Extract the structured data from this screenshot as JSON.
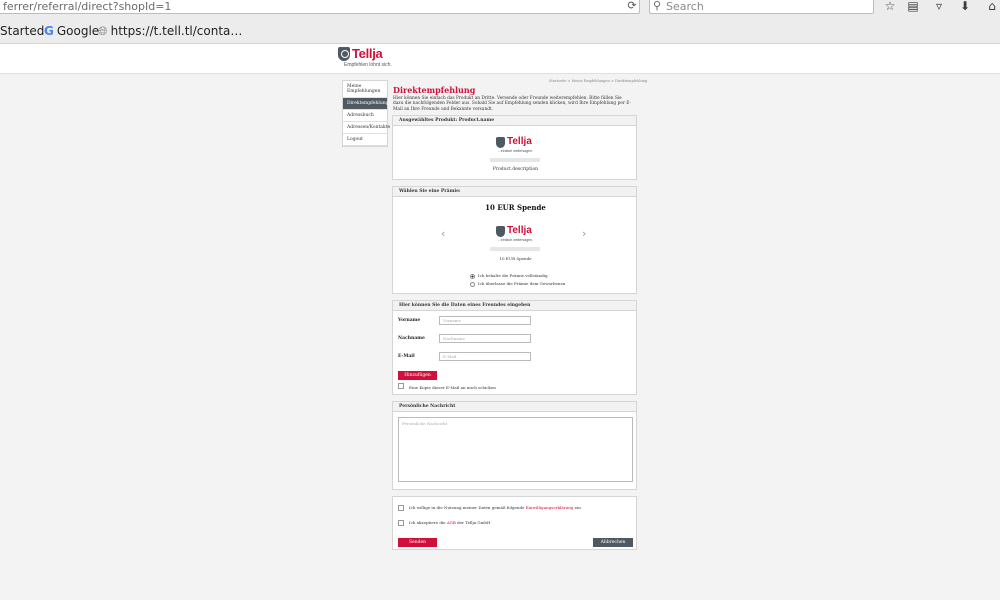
{
  "browser": {
    "url": "ferrer/referral/direct?shopId=1",
    "search_placeholder": "Search",
    "bookmarks": [
      "Started",
      "Google",
      "https://t.tell.tl/conta…"
    ]
  },
  "logo": {
    "name": "Tellja",
    "tagline": "Empfehlen lohnt sich."
  },
  "sidenav": {
    "items": [
      {
        "label": "Meine Empfehlungen",
        "active": false
      },
      {
        "label": "Direktempfehlung",
        "active": true
      },
      {
        "label": "Adressbuch",
        "active": false
      },
      {
        "label": "Adressen/Kontakte",
        "active": false
      },
      {
        "label": "Logout",
        "active": false
      }
    ]
  },
  "main": {
    "crumb": "Startseite > Meine Empfehlungen > Direktempfehlung",
    "title": "Direktempfehlung",
    "intro": "Hier können Sie einfach das Produkt an Dritte. Versende oder Freunde weiterempfehlen. Bitte füllen Sie dazu die nachfolgenden Felder aus. Sobald Sie auf Empfehlung senden klicken, wird Ihre Empfehlung per E-Mail an Ihre Freunde und Bekannte versandt."
  },
  "product": {
    "heading": "Ausgewähltes Produkt: Product.name",
    "image_sub": "...einfach weitersagen.",
    "description": "Product.description"
  },
  "reward": {
    "heading": "Wählen Sie eine Prämie:",
    "title": "10 EUR Spende",
    "image_sub": "...einfach weitersagen.",
    "caption": "10 EUR Spende",
    "options": [
      "Ich behalte die Prämie vollständig",
      "Ich überlasse die Prämie dem Geworbenen"
    ]
  },
  "friend": {
    "heading": "Hier können Sie die Daten eines Freundes eingeben",
    "fields": [
      {
        "label": "Vorname",
        "placeholder": "Vorname"
      },
      {
        "label": "Nachname",
        "placeholder": "Nachname"
      },
      {
        "label": "E-Mail",
        "placeholder": "E-Mail"
      }
    ],
    "add_button": "Hinzufügen",
    "copy_label": "Eine Kopie dieser E-Mail an mich schicken"
  },
  "message": {
    "heading": "Persönliche Nachricht",
    "placeholder": "Persönliche Nachricht"
  },
  "consent": {
    "consent1_pre": "Ich willige in die Nutzung meiner Daten gemäß folgende",
    "consent1_link": "Einwilligungserklärung",
    "consent1_post": "ein",
    "consent2_pre": "Ich akzeptiere die",
    "consent2_link": "AGB",
    "consent2_post": "der Tellja GmbH",
    "send_button": "Senden",
    "cancel_button": "Abbrechen"
  },
  "colors": {
    "brand": "#d0103a",
    "nav_active": "#4f5961"
  }
}
